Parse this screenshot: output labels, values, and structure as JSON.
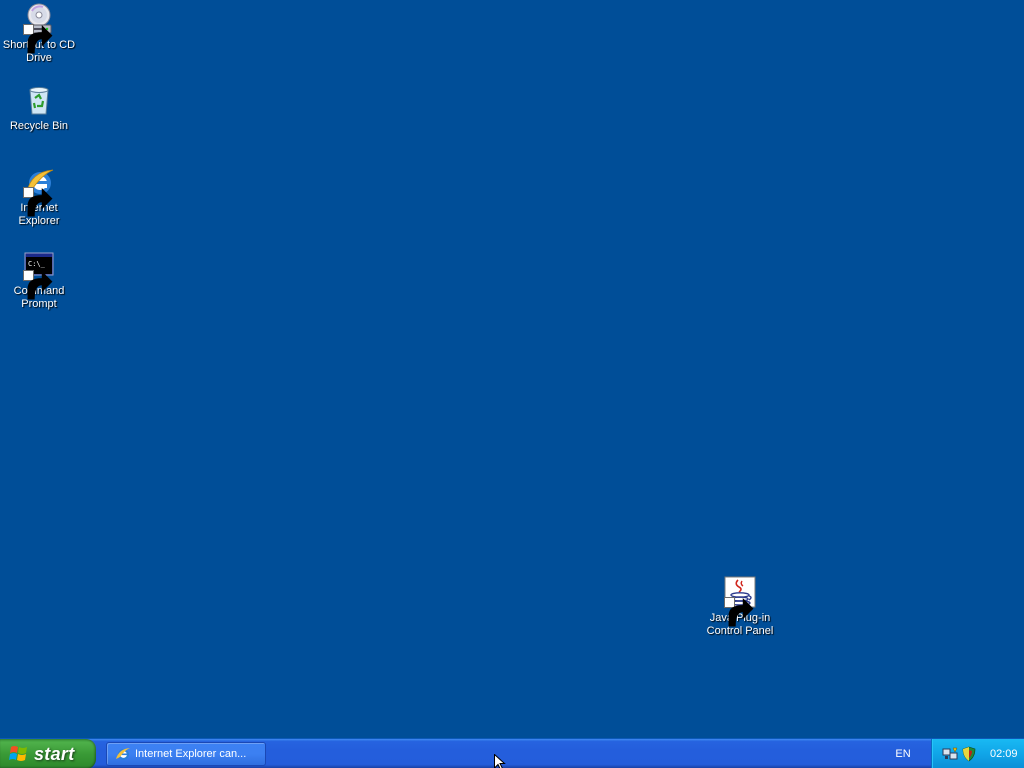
{
  "desktop": {
    "background_color": "#004E98",
    "icons": [
      {
        "label": "Shortcut to CD\nDrive",
        "icon": "cd-drive-icon",
        "shortcut": true
      },
      {
        "label": "Recycle Bin",
        "icon": "recycle-bin-icon",
        "shortcut": false
      },
      {
        "label": "Internet\nExplorer",
        "icon": "internet-explorer-icon",
        "shortcut": true
      },
      {
        "label": "Command\nPrompt",
        "icon": "command-prompt-icon",
        "shortcut": true
      },
      {
        "label": "Java Plug-in\nControl Panel",
        "icon": "java-icon",
        "shortcut": true
      }
    ]
  },
  "taskbar": {
    "start_label": "start",
    "tasks": [
      {
        "label": "Internet Explorer can...",
        "icon": "internet-explorer-icon"
      }
    ],
    "language": "EN",
    "tray_icons": [
      "network-icon",
      "security-shield-icon"
    ],
    "clock": "02:09",
    "colors": {
      "taskbar": "#245EDC",
      "start_button": "#3A9A36",
      "tray": "#10A5E8"
    }
  }
}
